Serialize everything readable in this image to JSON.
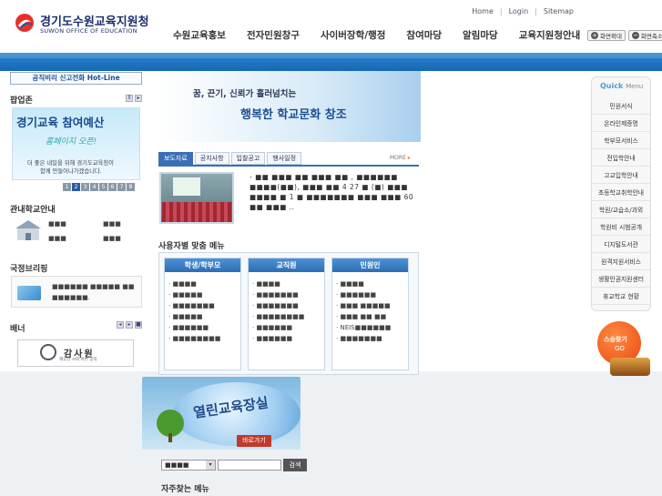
{
  "header": {
    "logo_kr": "경기도수원교육지원청",
    "logo_en": "SUWON OFFICE OF EDUCATION",
    "top_links": [
      "Home",
      "Login",
      "Sitemap"
    ],
    "gnb": [
      "수원교육홍보",
      "전자민원창구",
      "사이버장학/행정",
      "참여마당",
      "알림마당",
      "교육지원청안내"
    ],
    "zoom_in": "화면확대",
    "zoom_out": "화면축소"
  },
  "left": {
    "hotline": "공직비리 신고전화 Hot-Line",
    "popup_title": "팝업존",
    "popup_heading": "경기교육 참여예산",
    "popup_sub": "홈페이지 오픈!",
    "popup_line1": "더 좋은 내일을 위해 경기도교육청이",
    "popup_line2": "함께 만들어나가겠습니다.",
    "popup_pages": [
      "1",
      "2",
      "3",
      "4",
      "5",
      "6",
      "7",
      "8"
    ],
    "popup_active_page": "2",
    "school_title": "관내학교안내",
    "school_links": [
      "■■■",
      "■■■",
      "■■■",
      "■■■"
    ],
    "briefing_title": "국정브리핑",
    "briefing_text": "■■■■■■ ■■■■■ ■■ ■■■■■■.",
    "banner_title": "배너",
    "banner_text": "감사원",
    "banner_sub": "깨끗한 사회 바른 공직"
  },
  "center": {
    "hero_line1": "꿈, 끈기, 신뢰가 흘러넘치는",
    "hero_line2": "행복한 학교문화 창조",
    "tabs": [
      "보도자료",
      "공지사항",
      "입찰공고",
      "행사일정"
    ],
    "more_label": "MORE",
    "news_text": "- ■■ ■■■ ■■ ■■■ ■■ , ■■■■■■ ■■■■(■■), ■■■ ■■ 4 27 ■ (■) ■■■ ■■■■ ■ 1 ■ ■■■■■■■ ■■■ ■■■ 60 ■■ ■■■ ..",
    "audience_title": "사용자별 맞춤 메뉴",
    "audience": [
      {
        "head": "학생/학부모",
        "items": [
          "■■■■",
          "■■■■■",
          "■■■■■■■",
          "■■■■■",
          "■■■■■■",
          "■■■■■■■■"
        ]
      },
      {
        "head": "교직원",
        "items": [
          "■■■■",
          "■■■■■■■",
          "■■■■■■■",
          "■■■■■■■■",
          "■■■■■■",
          "■■■■■■"
        ]
      },
      {
        "head": "민원인",
        "items": [
          "■■■■",
          "■■■■■■",
          "■■■ ■■■■■",
          "■■■ ■■ ■■",
          "NEIS■■■■■■",
          "■■■■■■■"
        ]
      }
    ]
  },
  "quick": {
    "title": "Quick",
    "title_sub": "Menu",
    "items": [
      "민원서식",
      "온라인제증명",
      "학부모서비스",
      "전입학안내",
      "고교입학안내",
      "초등학교취학안내",
      "학원/교습소/과외",
      "학원비 시범공개",
      "디지털도서관",
      "원격지원서비스",
      "생활인권지원센터",
      "휴교학교 현황"
    ],
    "ssam_label": "스승찾기",
    "ssam_go": "GO"
  },
  "bottom": {
    "open_title": "열린교육장실",
    "open_go": "바로가기",
    "search_select": "■■■■",
    "search_btn": "검색",
    "freq_title": "자주찾는 메뉴"
  },
  "colors": {
    "brand_blue": "#1767b3",
    "tab_active": "#3a6fb5",
    "quick_title": "#4a9ed8"
  }
}
